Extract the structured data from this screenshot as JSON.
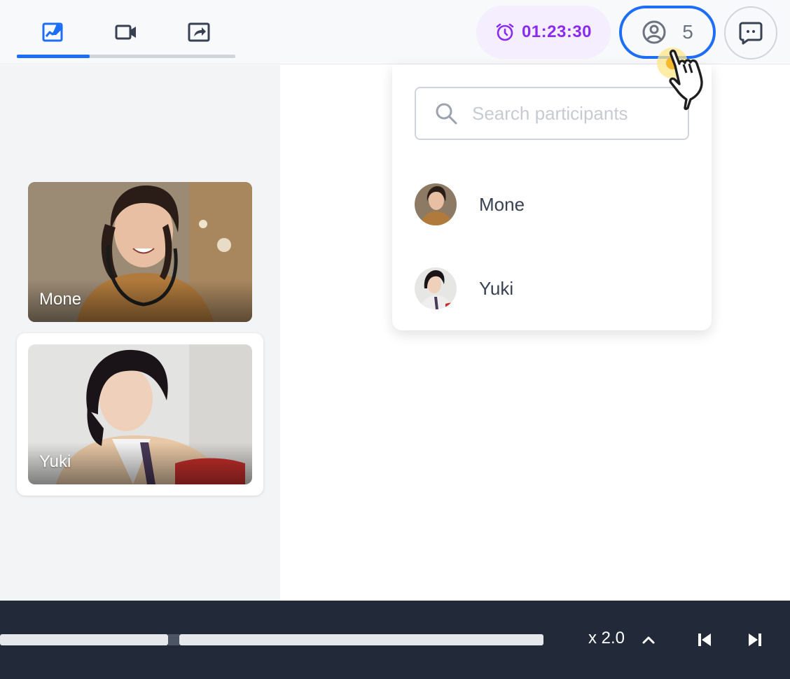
{
  "topbar": {
    "tabs": [
      {
        "name": "whiteboard",
        "icon": "chart-edit-icon",
        "active": true
      },
      {
        "name": "video",
        "icon": "video-camera-icon",
        "active": false
      },
      {
        "name": "share",
        "icon": "share-screen-icon",
        "active": false
      }
    ],
    "timer": {
      "text": "01:23:30",
      "icon": "alarm-clock-icon",
      "color": "#8b2bf0"
    },
    "participants": {
      "count": "5",
      "icon": "user-circle-icon"
    },
    "chat": {
      "icon": "chat-bubble-icon"
    }
  },
  "sidebar": {
    "tiles": [
      {
        "name": "Mone"
      },
      {
        "name": "Yuki"
      }
    ]
  },
  "participants_dropdown": {
    "search_placeholder": "Search participants",
    "items": [
      {
        "name": "Mone"
      },
      {
        "name": "Yuki"
      }
    ]
  },
  "playback": {
    "speed": "x 2.0",
    "colors": {
      "bar": "#222a39",
      "track": "#e5e7eb"
    }
  },
  "colors": {
    "accent": "#1d6ef7",
    "timer_bg": "#f4eefe"
  }
}
